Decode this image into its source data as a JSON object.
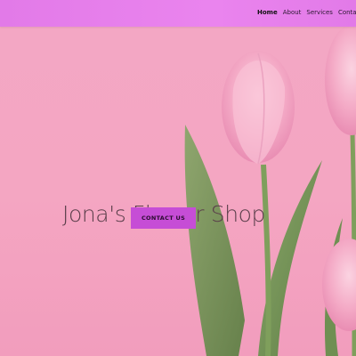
{
  "nav": {
    "items": [
      {
        "label": "Home",
        "active": true
      },
      {
        "label": "About",
        "active": false
      },
      {
        "label": "Services",
        "active": false
      },
      {
        "label": "Contacts",
        "active": false
      }
    ]
  },
  "hero": {
    "title": "Jona's Flower Shop",
    "button_label": "CONTACT US"
  },
  "colors": {
    "navbar": "#ea84ee",
    "background": "#f4a6c2",
    "button": "#c64dd6",
    "tulip": "#f7b8cf",
    "stem": "#7a9a5a"
  }
}
